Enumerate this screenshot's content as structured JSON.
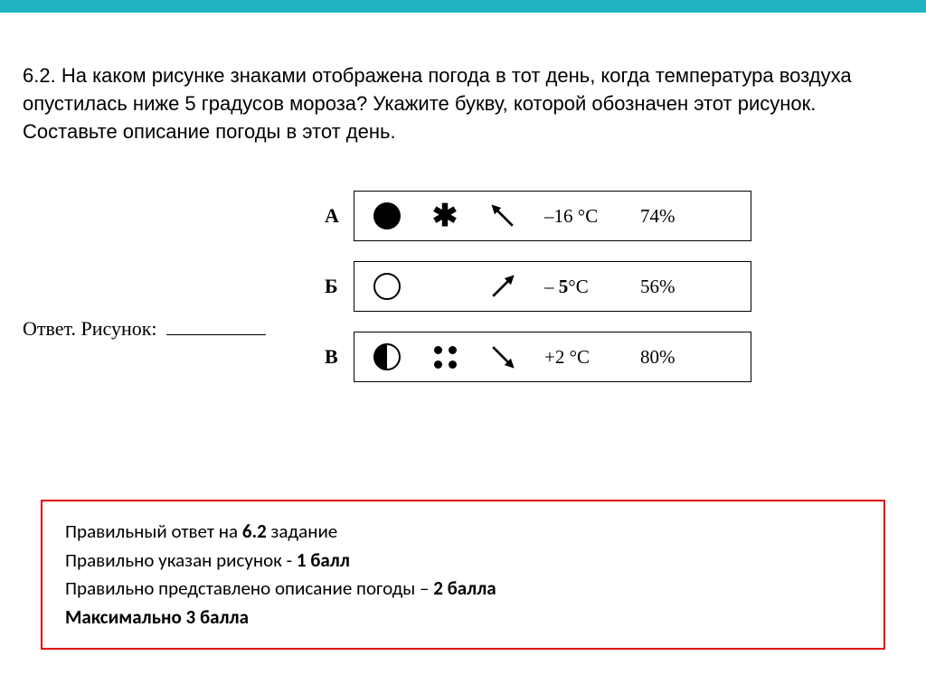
{
  "question": {
    "number": "6.2.",
    "text": "На каком рисунке знаками отображена погода в тот день, когда температура воздуха опустилась ниже 5 градусов мороза? Укажите букву, которой обозначен этот рисунок. Составьте описание погоды в этот день."
  },
  "answer_label": "Ответ. Рисунок:",
  "options": [
    {
      "letter": "А",
      "temp": "–16 °C",
      "humidity": "74%"
    },
    {
      "letter": "Б",
      "temp": "– 5°C",
      "humidity": "56%"
    },
    {
      "letter": "В",
      "temp": "+2 °C",
      "humidity": "80%"
    }
  ],
  "scoring": {
    "line1_pre": "Правильный ответ на ",
    "line1_bold": "6.2",
    "line1_post": " задание",
    "line2_pre": "Правильно указан рисунок - ",
    "line2_bold": "1 балл",
    "line3_pre": "Правильно представлено описание погоды – ",
    "line3_bold": "2 балла",
    "line4": "Максимально 3 балла"
  }
}
